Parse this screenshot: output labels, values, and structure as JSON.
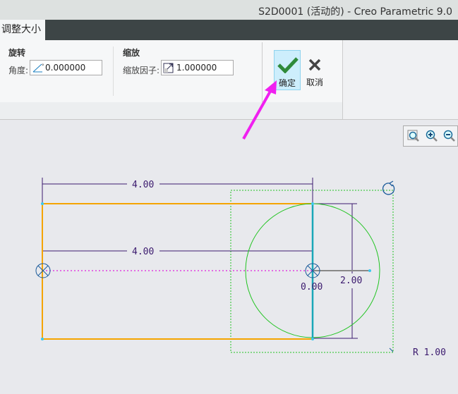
{
  "window": {
    "title": "S2D0001 (活动的) - Creo Parametric 9.0"
  },
  "tab": {
    "label": "调整大小"
  },
  "rotate": {
    "group": "旋转",
    "angle_label": "角度:",
    "angle_value": "0.000000"
  },
  "scale": {
    "group": "缩放",
    "factor_label": "缩放因子:",
    "factor_value": "1.000000"
  },
  "actions": {
    "ok": "确定",
    "cancel": "取消"
  },
  "sketch": {
    "dim_top": "4.00",
    "dim_mid": "4.00",
    "dim_height": "2.00",
    "dim_center": "0.00",
    "radius": "R 1.00"
  },
  "colors": {
    "rect": "#f5a400",
    "circle": "#22c422",
    "dim": "#3b1a6e",
    "accent": "#f020f0",
    "line": "#19a7b7"
  }
}
